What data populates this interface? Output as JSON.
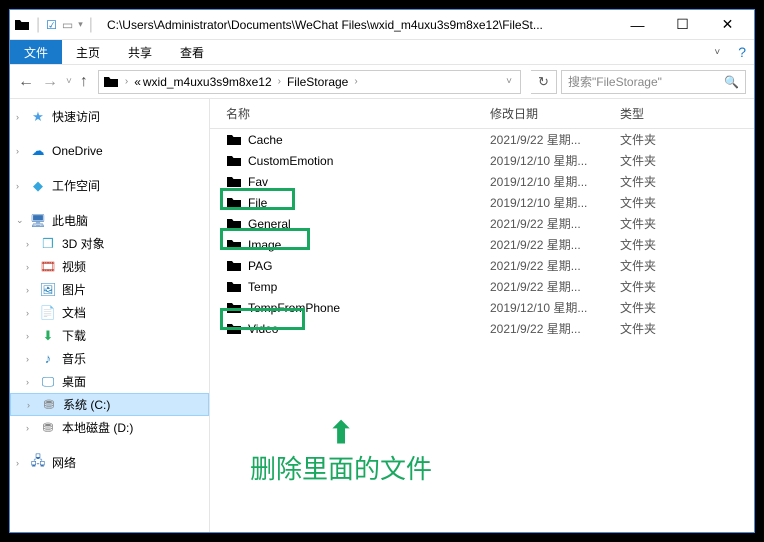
{
  "titlebar": {
    "path": "C:\\Users\\Administrator\\Documents\\WeChat Files\\wxid_m4uxu3s9m8xe12\\FileSt..."
  },
  "ribbon": {
    "file": "文件",
    "home": "主页",
    "share": "共享",
    "view": "查看"
  },
  "breadcrumb": {
    "seg1": "wxid_m4uxu3s9m8xe12",
    "seg2": "FileStorage"
  },
  "search": {
    "placeholder": "搜索\"FileStorage\""
  },
  "sidebar": {
    "quick": "快速访问",
    "onedrive": "OneDrive",
    "workspace": "工作空间",
    "pc": "此电脑",
    "items": {
      "d3d": "3D 对象",
      "video": "视频",
      "pictures": "图片",
      "docs": "文档",
      "downloads": "下载",
      "music": "音乐",
      "desktop": "桌面",
      "cdrive": "系统 (C:)",
      "ddrive": "本地磁盘 (D:)"
    },
    "network": "网络"
  },
  "columns": {
    "name": "名称",
    "date": "修改日期",
    "type": "类型"
  },
  "files": [
    {
      "name": "Cache",
      "date": "2021/9/22 星期...",
      "type": "文件夹"
    },
    {
      "name": "CustomEmotion",
      "date": "2019/12/10 星期...",
      "type": "文件夹"
    },
    {
      "name": "Fav",
      "date": "2019/12/10 星期...",
      "type": "文件夹"
    },
    {
      "name": "File",
      "date": "2019/12/10 星期...",
      "type": "文件夹"
    },
    {
      "name": "General",
      "date": "2021/9/22 星期...",
      "type": "文件夹"
    },
    {
      "name": "Image",
      "date": "2021/9/22 星期...",
      "type": "文件夹"
    },
    {
      "name": "PAG",
      "date": "2021/9/22 星期...",
      "type": "文件夹"
    },
    {
      "name": "Temp",
      "date": "2021/9/22 星期...",
      "type": "文件夹"
    },
    {
      "name": "TempFromPhone",
      "date": "2019/12/10 星期...",
      "type": "文件夹"
    },
    {
      "name": "Video",
      "date": "2021/9/22 星期...",
      "type": "文件夹"
    }
  ],
  "annotation": {
    "text": "删除里面的文件"
  }
}
